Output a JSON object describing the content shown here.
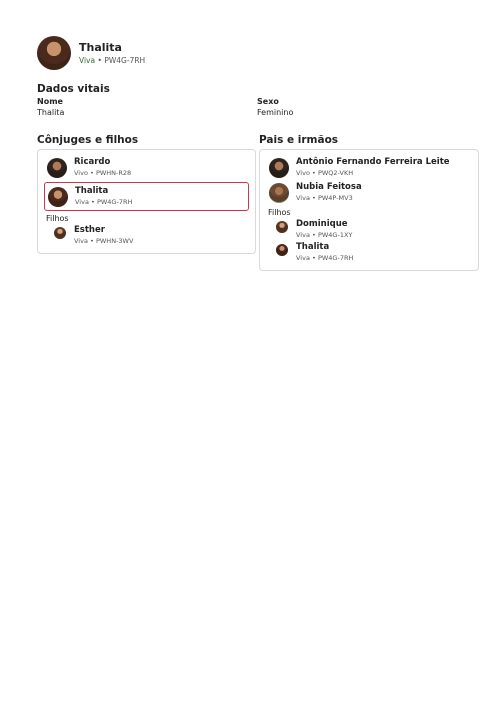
{
  "header": {
    "name": "Thalita",
    "status": "Viva",
    "id": "PW4G-7RH"
  },
  "vitals": {
    "title": "Dados vitais",
    "name_label": "Nome",
    "name_value": "Thalita",
    "sex_label": "Sexo",
    "sex_value": "Feminino"
  },
  "spouses": {
    "title": "Cônjuges e filhos",
    "spouse": {
      "name": "Ricardo",
      "status": "Vivo",
      "id": "PWHN-R28"
    },
    "self": {
      "name": "Thalita",
      "status": "Viva",
      "id": "PW4G-7RH"
    },
    "children_label": "Filhos",
    "children": [
      {
        "name": "Esther",
        "status": "Viva",
        "id": "PWHN-3WV"
      }
    ]
  },
  "parents": {
    "title": "Pais e irmãos",
    "father": {
      "name": "Antônio Fernando Ferreira Leite",
      "status": "Vivo",
      "id": "PWQ2-VKH"
    },
    "mother": {
      "name": "Nubia Feitosa",
      "status": "Viva",
      "id": "PW4P-MV3"
    },
    "children_label": "Filhos",
    "children": [
      {
        "name": "Dominique",
        "status": "Viva",
        "id": "PW4G-1XY"
      },
      {
        "name": "Thalita",
        "status": "Viva",
        "id": "PW4G-7RH"
      }
    ]
  },
  "separator": "•"
}
